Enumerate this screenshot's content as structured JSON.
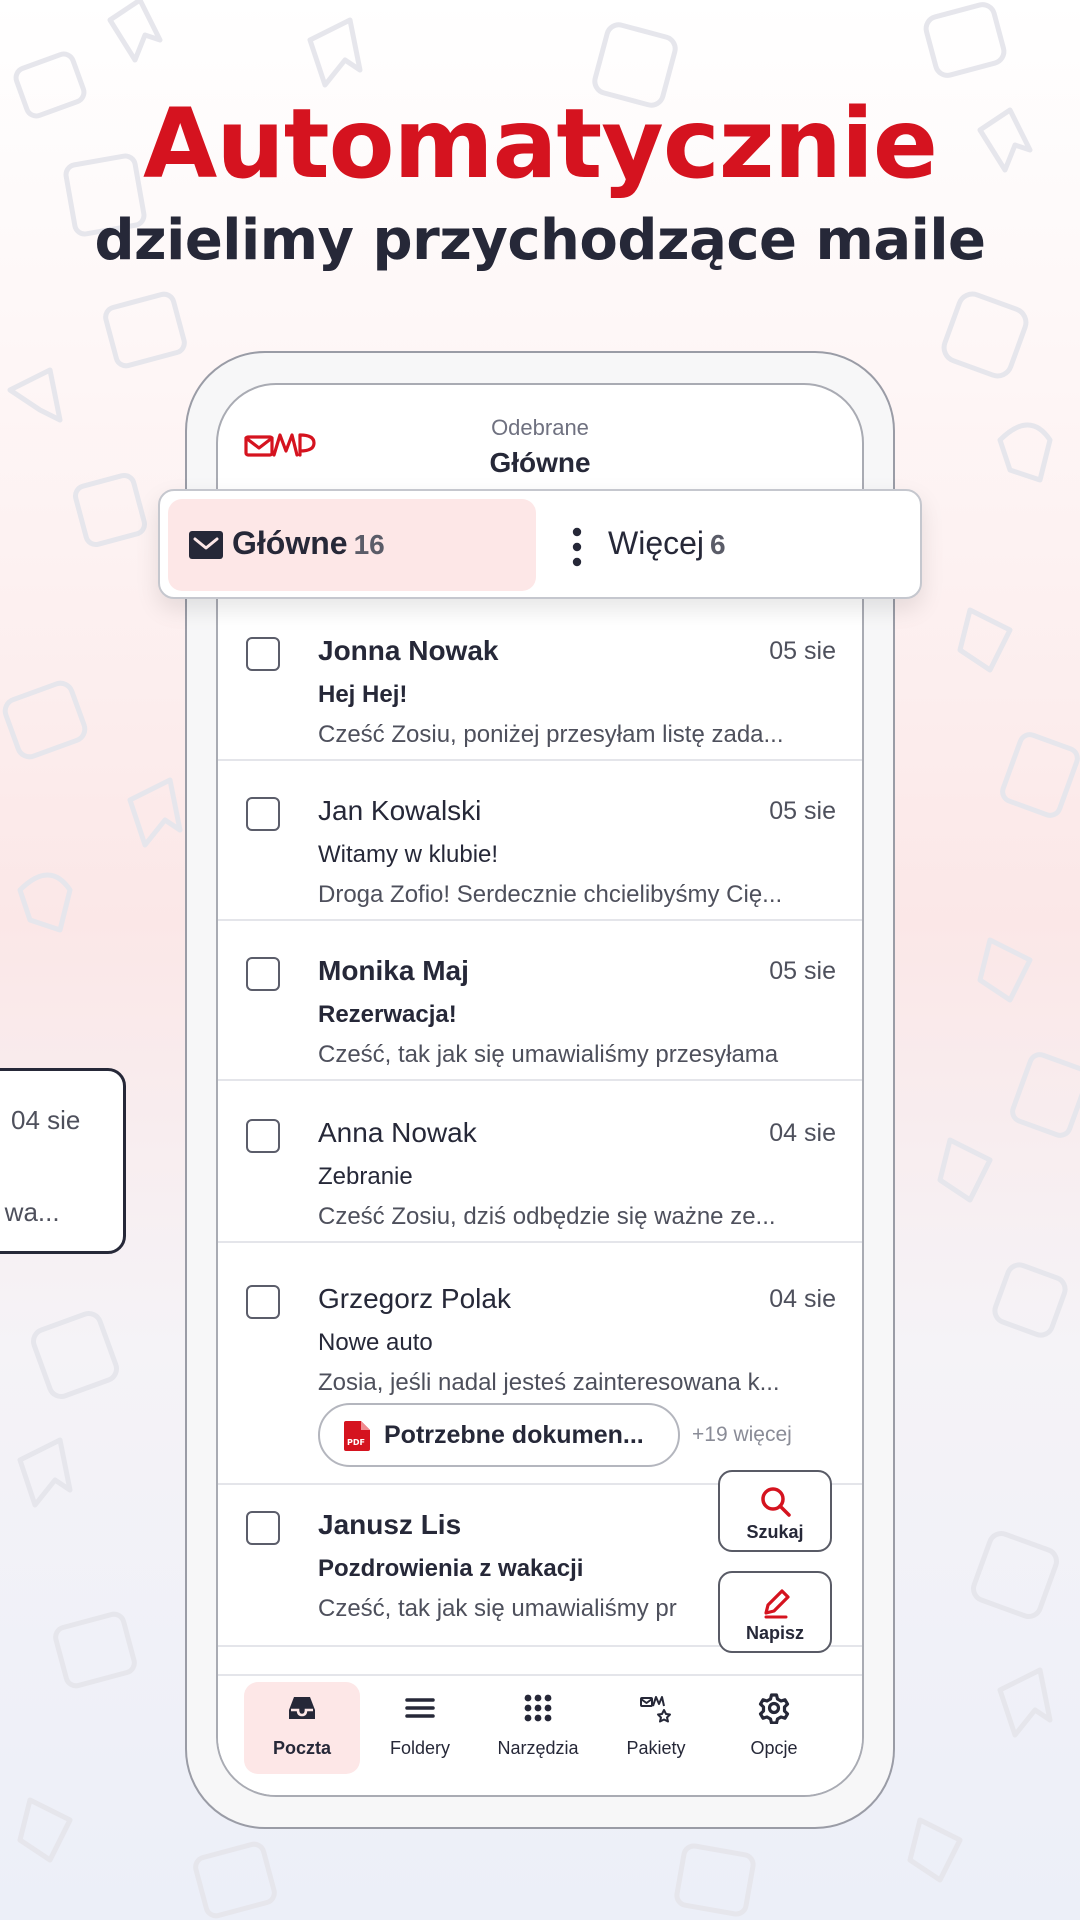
{
  "hero": {
    "title": "Automatycznie",
    "subtitle": "dzielimy przychodzące maile"
  },
  "colors": {
    "accent": "#d5131f",
    "dark": "#262838",
    "tab_bg": "#fde7e7"
  },
  "header": {
    "logo": "wp-mail-logo",
    "folder": "Odebrane",
    "title": "Główne"
  },
  "tabs": {
    "main": {
      "icon": "envelope-icon",
      "label": "Główne",
      "count": "16"
    },
    "more": {
      "icon": "kebab-menu-icon",
      "label": "Więcej",
      "count": "6"
    }
  },
  "emails": [
    {
      "sender": "Jonna Nowak",
      "date": "05 sie",
      "subject": "Hej Hej!",
      "preview": "Cześć Zosiu, poniżej przesyłam listę zada...",
      "unread": true
    },
    {
      "sender": "Jan Kowalski",
      "date": "05 sie",
      "subject": "Witamy w klubie!",
      "preview": "Droga Zofio! Serdecznie chcielibyśmy Cię...",
      "unread": false
    },
    {
      "sender": "Monika Maj",
      "date": "05 sie",
      "subject": "Rezerwacja!",
      "preview": "Cześć, tak jak się umawialiśmy przesyłama",
      "unread": true
    },
    {
      "sender": "Anna Nowak",
      "date": "04 sie",
      "subject": "Zebranie",
      "preview": "Cześć Zosiu, dziś odbędzie się ważne ze...",
      "unread": false
    },
    {
      "sender": "Grzegorz Polak",
      "date": "04 sie",
      "subject": "Nowe auto",
      "preview": "Zosia, jeśli nadal jesteś zainteresowana k...",
      "unread": false,
      "attachment": {
        "icon": "pdf-icon",
        "name": "Potrzebne dokumen...",
        "more": "+19 więcej"
      }
    },
    {
      "sender": "Janusz Lis",
      "date": "",
      "subject": "Pozdrowienia z wakacji",
      "preview": "Cześć, tak jak się umawialiśmy pr",
      "unread": true
    }
  ],
  "fabs": {
    "search": {
      "icon": "search-icon",
      "label": "Szukaj"
    },
    "compose": {
      "icon": "pencil-icon",
      "label": "Napisz"
    }
  },
  "nav": [
    {
      "icon": "inbox-icon",
      "label": "Poczta",
      "active": true
    },
    {
      "icon": "menu-icon",
      "label": "Foldery",
      "active": false
    },
    {
      "icon": "grid-icon",
      "label": "Narzędzia",
      "active": false
    },
    {
      "icon": "packages-icon",
      "label": "Pakiety",
      "active": false
    },
    {
      "icon": "gear-icon",
      "label": "Opcje",
      "active": false
    }
  ],
  "side_card": {
    "date": "04 sie",
    "preview": "ę wa..."
  }
}
